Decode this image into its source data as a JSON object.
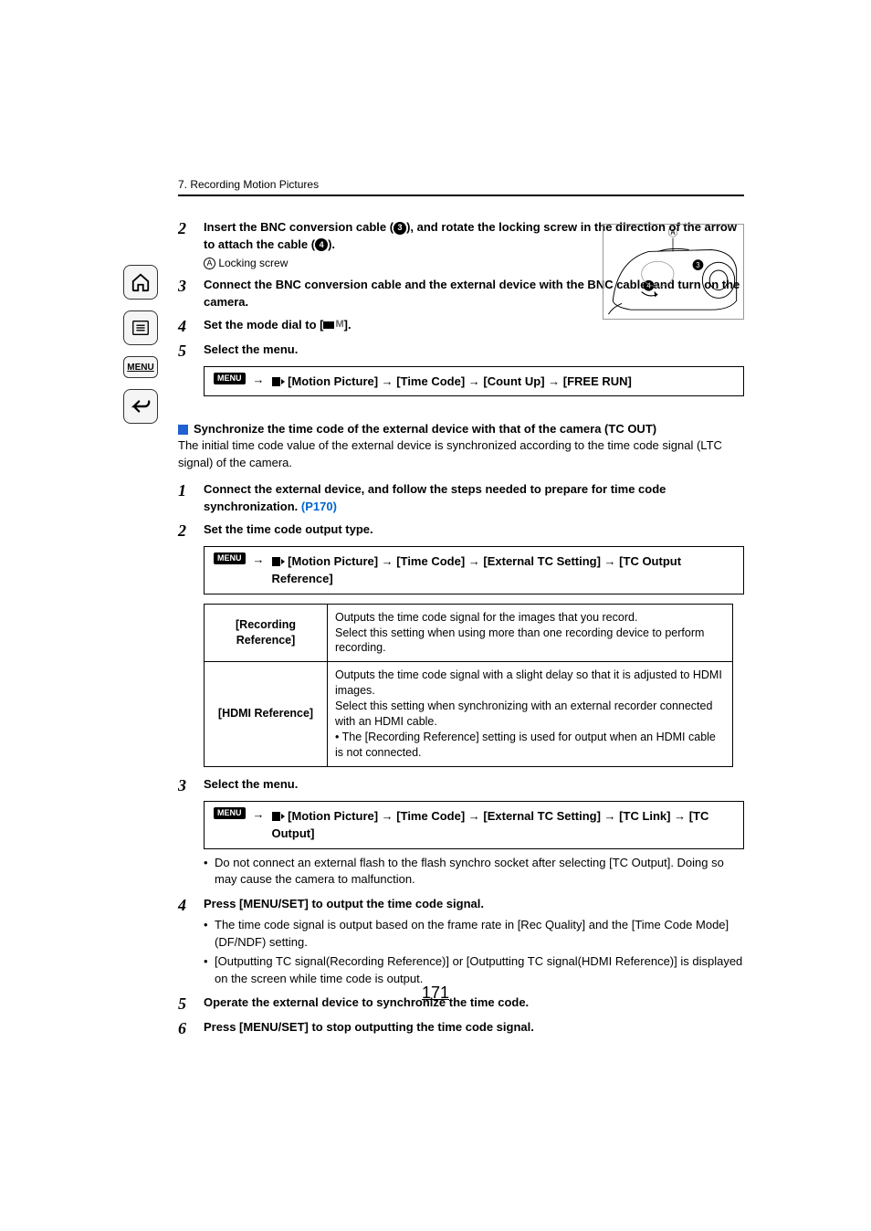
{
  "chapter": "7. Recording Motion Pictures",
  "sidebar": {
    "menu_label": "MENU"
  },
  "illustration": {
    "label_A": "A",
    "mark_3": "3",
    "mark_4": "4"
  },
  "steps_top": [
    {
      "num": "2",
      "lead": "Insert the BNC conversion cable (",
      "mark1": "3",
      "mid": "), and rotate the locking screw in the direction of the arrow to attach the cable (",
      "mark2": "4",
      "tail": ").",
      "sub_letter": "A",
      "sub_text": " Locking screw"
    },
    {
      "num": "3",
      "text": "Connect the BNC conversion cable and the external device with the BNC cable, and turn on the camera."
    },
    {
      "num": "4",
      "lead": "Set the mode dial to [",
      "tail": "]."
    },
    {
      "num": "5",
      "text": "Select the menu."
    }
  ],
  "menu1": {
    "label": "MENU",
    "path": "[Motion Picture] → [Time Code] → [Count Up] → [FREE RUN]"
  },
  "tc_out": {
    "title": "Synchronize the time code of the external device with that of the camera (TC OUT)",
    "desc": "The initial time code value of the external device is synchronized according to the time code signal (LTC signal) of the camera."
  },
  "steps_tc": [
    {
      "num": "1",
      "lead": "Connect the external device, and follow the steps needed to prepare for time code synchronization. ",
      "link": "(P170)"
    },
    {
      "num": "2",
      "text": "Set the time code output type."
    }
  ],
  "menu2": {
    "label": "MENU",
    "path": "[Motion Picture] → [Time Code] → [External TC Setting] → [TC Output Reference]"
  },
  "table": {
    "r1_head": "[Recording Reference]",
    "r1_body": "Outputs the time code signal for the images that you record.\nSelect this setting when using more than one recording device to perform recording.",
    "r2_head": "[HDMI Reference]",
    "r2_body": "Outputs the time code signal with a slight delay so that it is adjusted to HDMI images.\nSelect this setting when synchronizing with an external recorder connected with an HDMI cable.\n• The [Recording Reference] setting is used for output when an HDMI cable is not connected."
  },
  "step3": {
    "num": "3",
    "text": "Select the menu."
  },
  "menu3": {
    "label": "MENU",
    "path": "[Motion Picture] → [Time Code] → [External TC Setting] → [TC Link] → [TC Output]"
  },
  "note3": "Do not connect an external flash to the flash synchro socket after selecting [TC Output]. Doing so may cause the camera to malfunction.",
  "steps_bottom": [
    {
      "num": "4",
      "text": "Press [MENU/SET] to output the time code signal.",
      "bullets": [
        "The time code signal is output based on the frame rate in [Rec Quality] and the [Time Code Mode] (DF/NDF) setting.",
        "[Outputting TC signal(Recording Reference)] or [Outputting TC signal(HDMI Reference)] is displayed on the screen while time code is output."
      ]
    },
    {
      "num": "5",
      "text": "Operate the external device to synchronize the time code."
    },
    {
      "num": "6",
      "text": "Press [MENU/SET] to stop outputting the time code signal."
    }
  ],
  "page_number": "171"
}
